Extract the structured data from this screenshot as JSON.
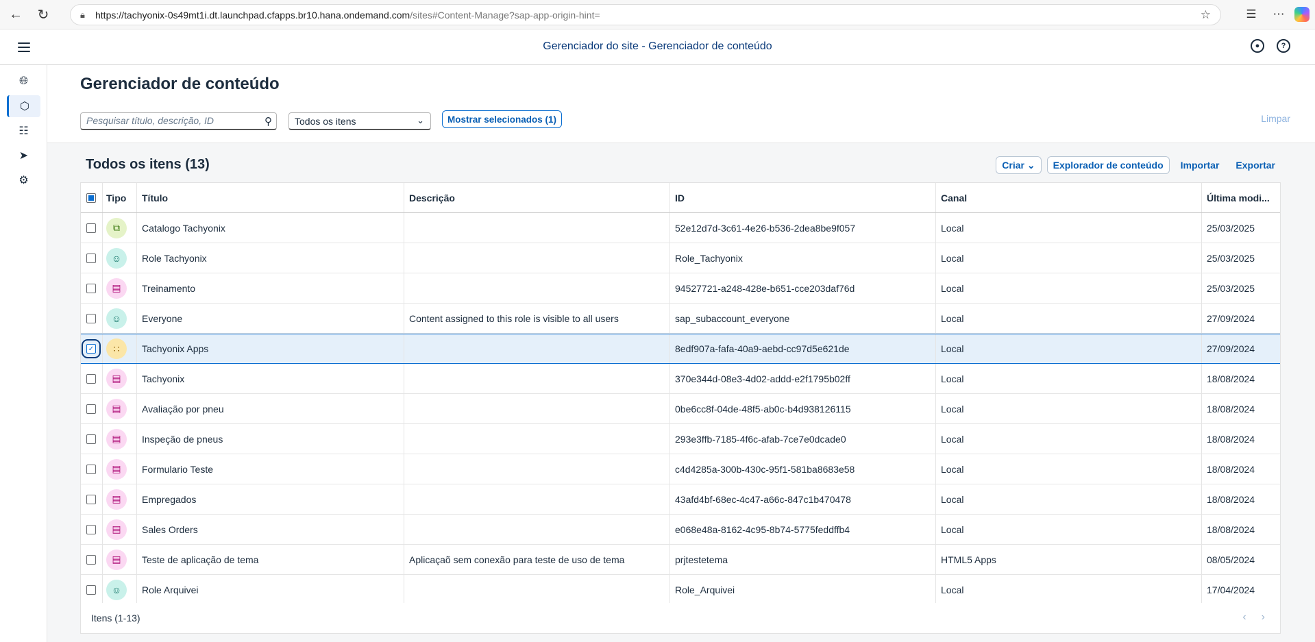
{
  "browser": {
    "url_host": "https://tachyonix-0s49mt1i.dt.launchpad.cfapps.br10.hana.ondemand.com",
    "url_path": "/sites#Content-Manage?sap-app-origin-hint="
  },
  "shell": {
    "title": "Gerenciador do site - Gerenciador de conteúdo"
  },
  "page": {
    "title": "Gerenciador de conteúdo",
    "search_placeholder": "Pesquisar título, descrição, ID",
    "filter_value": "Todos os itens",
    "show_selected": "Mostrar selecionados (1)",
    "clear": "Limpar"
  },
  "table": {
    "title": "Todos os itens (13)",
    "toolbar": {
      "create": "Criar",
      "explorer": "Explorador de conteúdo",
      "import": "Importar",
      "export": "Exportar"
    },
    "columns": {
      "type": "Tipo",
      "title": "Título",
      "description": "Descrição",
      "id": "ID",
      "channel": "Canal",
      "modified": "Última modi..."
    },
    "rows": [
      {
        "type": "catalog",
        "title": "Catalogo Tachyonix",
        "description": "",
        "id": "52e12d7d-3c61-4e26-b536-2dea8be9f057",
        "channel": "Local",
        "modified": "25/03/2025",
        "selected": false
      },
      {
        "type": "role",
        "title": "Role Tachyonix",
        "description": "",
        "id": "Role_Tachyonix",
        "channel": "Local",
        "modified": "25/03/2025",
        "selected": false
      },
      {
        "type": "app",
        "title": "Treinamento",
        "description": "",
        "id": "94527721-a248-428e-b651-cce203daf76d",
        "channel": "Local",
        "modified": "25/03/2025",
        "selected": false
      },
      {
        "type": "role",
        "title": "Everyone",
        "description": "Content assigned to this role is visible to all users",
        "id": "sap_subaccount_everyone",
        "channel": "Local",
        "modified": "27/09/2024",
        "selected": false
      },
      {
        "type": "group",
        "title": "Tachyonix Apps",
        "description": "",
        "id": "8edf907a-fafa-40a9-aebd-cc97d5e621de",
        "channel": "Local",
        "modified": "27/09/2024",
        "selected": true
      },
      {
        "type": "app",
        "title": "Tachyonix",
        "description": "",
        "id": "370e344d-08e3-4d02-addd-e2f1795b02ff",
        "channel": "Local",
        "modified": "18/08/2024",
        "selected": false
      },
      {
        "type": "app",
        "title": "Avaliação por pneu",
        "description": "",
        "id": "0be6cc8f-04de-48f5-ab0c-b4d938126115",
        "channel": "Local",
        "modified": "18/08/2024",
        "selected": false
      },
      {
        "type": "app",
        "title": "Inspeção de pneus",
        "description": "",
        "id": "293e3ffb-7185-4f6c-afab-7ce7e0dcade0",
        "channel": "Local",
        "modified": "18/08/2024",
        "selected": false
      },
      {
        "type": "app",
        "title": "Formulario Teste",
        "description": "",
        "id": "c4d4285a-300b-430c-95f1-581ba8683e58",
        "channel": "Local",
        "modified": "18/08/2024",
        "selected": false
      },
      {
        "type": "app",
        "title": "Empregados",
        "description": "",
        "id": "43afd4bf-68ec-4c47-a66c-847c1b470478",
        "channel": "Local",
        "modified": "18/08/2024",
        "selected": false
      },
      {
        "type": "app",
        "title": "Sales Orders",
        "description": "",
        "id": "e068e48a-8162-4c95-8b74-5775feddffb4",
        "channel": "Local",
        "modified": "18/08/2024",
        "selected": false
      },
      {
        "type": "app",
        "title": "Teste de aplicação de tema",
        "description": "Aplicaçaõ sem conexão para teste de uso de tema",
        "id": "prjtestetema",
        "channel": "HTML5 Apps",
        "modified": "08/05/2024",
        "selected": false
      },
      {
        "type": "role",
        "title": "Role Arquivei",
        "description": "",
        "id": "Role_Arquivei",
        "channel": "Local",
        "modified": "17/04/2024",
        "selected": false
      }
    ],
    "footer_count": "Itens (1-13)"
  }
}
